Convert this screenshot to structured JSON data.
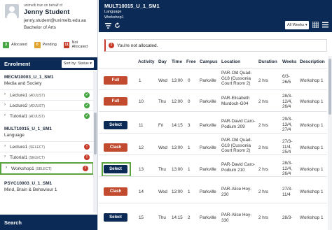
{
  "profile": {
    "on_behalf": "unimelb tran on behalf of",
    "name": "Jenny Student",
    "email": "jenny.student@unimelb.edu.au",
    "degree": "Bachelor of Arts"
  },
  "counts": [
    {
      "value": "3",
      "label": "Allocated",
      "color": "#47a744"
    },
    {
      "value": "0",
      "label": "Pending",
      "color": "#e0a22c"
    },
    {
      "value": "11",
      "label": "Not Allocated",
      "color": "#c73a2a"
    }
  ],
  "enrolment": {
    "title": "Enrolment",
    "sort_label": "Sort by: Status ▾"
  },
  "subjects": [
    {
      "code": "MECM10003_U_1_SM1",
      "name": "Media and Society"
    },
    {
      "code": "MULT10015_U_1_SM1",
      "name": "Language"
    },
    {
      "code": "PSYC10003_U_1_SM1",
      "name": "Mind, Brain & Behaviour 1"
    }
  ],
  "classes": [
    {
      "name": "Lecture1",
      "tag": "(ADJUST)",
      "status": "✓"
    },
    {
      "name": "Lecture2",
      "tag": "(ADJUST)",
      "status": "✓"
    },
    {
      "name": "Tutorial1",
      "tag": "(ADJUST)",
      "status": "✓"
    },
    {
      "name": "Lecture1",
      "tag": "(SELECT)",
      "status": "!"
    },
    {
      "name": "Tutorial1",
      "tag": "(SELECT)",
      "status": "!"
    },
    {
      "name": "Workshop1",
      "tag": "(SELECT)",
      "status": "!"
    }
  ],
  "search": {
    "label": "Search"
  },
  "main": {
    "code": "MULT10015_U_1_SM1",
    "subject": "Language",
    "class": "Workshop1",
    "weeks_select": "All Weeks ▾"
  },
  "alert": {
    "icon": "!",
    "text": "You're not allocated."
  },
  "table": {
    "headers": [
      "Activity",
      "Day",
      "Time",
      "Free",
      "Campus",
      "Location",
      "Duration",
      "Weeks",
      "Description"
    ],
    "rows": [
      {
        "button": "Full",
        "activity": "1",
        "day": "Wed",
        "time": "13:00",
        "free": "0",
        "campus": "Parkville",
        "location": "PAR-Old Quad-G18 (Cussonia Court Room 2)",
        "duration": "2 hrs",
        "weeks": "6/3-26/5",
        "description": "Workshop 1"
      },
      {
        "button": "Full",
        "activity": "10",
        "day": "Thu",
        "time": "12:00",
        "free": "0",
        "campus": "Parkville",
        "location": "PAR-Elisabeth Murdoch-G04",
        "duration": "2 hrs",
        "weeks": "28/3-12/4, 26/4",
        "description": "Workshop 1"
      },
      {
        "button": "Select",
        "activity": "11",
        "day": "Fri",
        "time": "14:15",
        "free": "3",
        "campus": "Parkville",
        "location": "PAR-David Caro-Podium 209",
        "duration": "2 hrs",
        "weeks": "29/3-13/4, 27/4",
        "description": "Workshop 1"
      },
      {
        "button": "Clash",
        "activity": "12",
        "day": "Wed",
        "time": "13:00",
        "free": "1",
        "campus": "Parkville",
        "location": "PAR-Old Quad-G18 (Cussonia Court Room 2)",
        "duration": "2 hrs",
        "weeks": "27/3-11/4, 25/4",
        "description": "Workshop 1"
      },
      {
        "button": "Select",
        "activity": "13",
        "day": "Thu",
        "time": "13:00",
        "free": "1",
        "campus": "Parkville",
        "location": "PAR-David Caro-Podium 210",
        "duration": "2 hrs",
        "weeks": "28/3-12/4, 26/4",
        "description": "Workshop 1"
      },
      {
        "button": "Clash",
        "activity": "14",
        "day": "Wed",
        "time": "13:00",
        "free": "1",
        "campus": "Parkville",
        "location": "PAR-Alice Hoy-230",
        "duration": "2 hrs",
        "weeks": "27/3-11/4",
        "description": "Workshop 1"
      },
      {
        "button": "Select",
        "activity": "15",
        "day": "Thu",
        "time": "14:15",
        "free": "2",
        "campus": "Parkville",
        "location": "PAR-Alice Hoy-330",
        "duration": "2 hrs",
        "weeks": "28/3-",
        "description": "Workshop 1"
      }
    ]
  }
}
